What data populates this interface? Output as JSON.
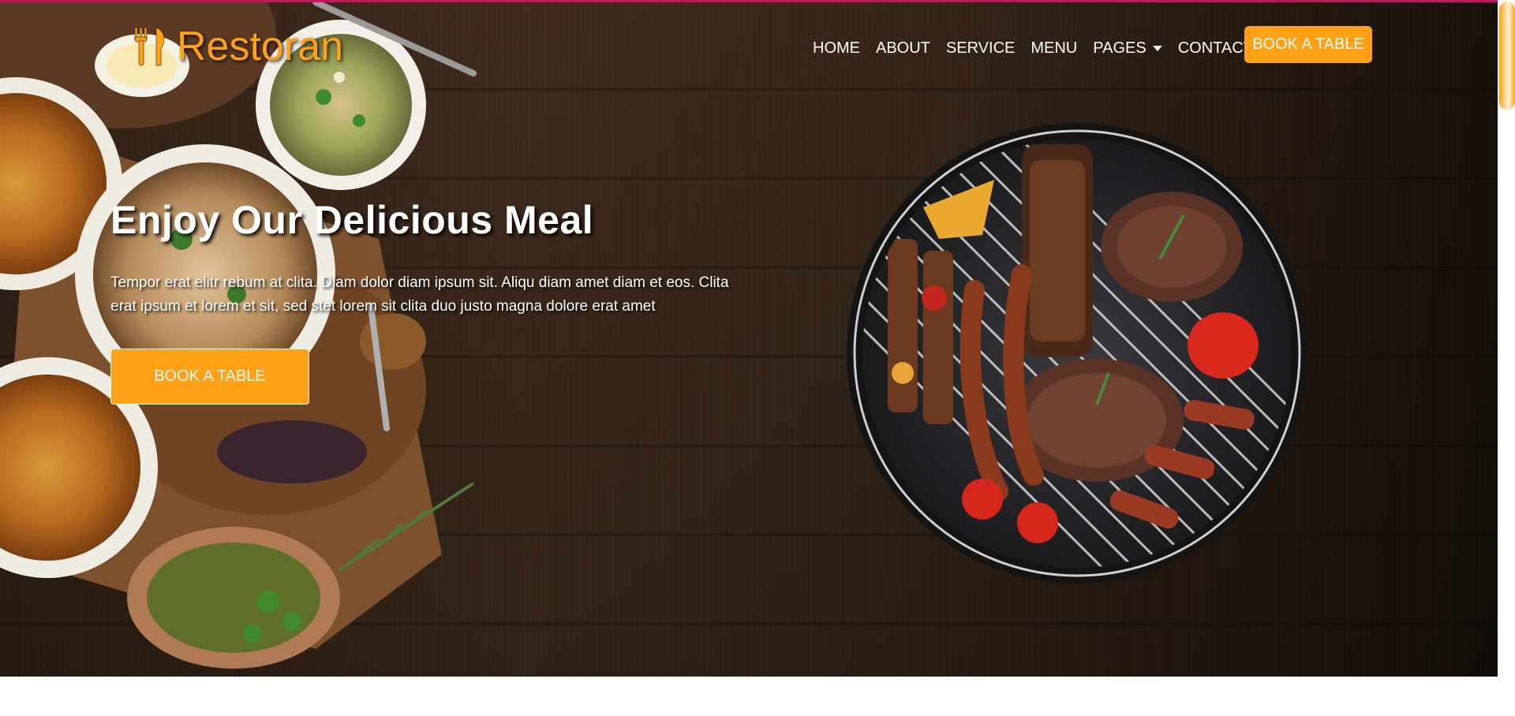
{
  "brand": {
    "name": "Restoran",
    "icon": "utensils-icon",
    "color": "#FEA116"
  },
  "nav": {
    "items": [
      {
        "label": "HOME"
      },
      {
        "label": "ABOUT"
      },
      {
        "label": "SERVICE"
      },
      {
        "label": "MENU"
      },
      {
        "label": "PAGES",
        "dropdown": true
      },
      {
        "label": "CONTACT"
      }
    ],
    "cta_label": "BOOK A TABLE"
  },
  "hero": {
    "title": "Enjoy Our Delicious Meal",
    "text": "Tempor erat elitr rebum at clita. Diam dolor diam ipsum sit. Aliqu diam amet diam et eos. Clita erat ipsum et lorem et sit, sed stet lorem sit clita duo justo magna dolore erat amet",
    "button_label": "BOOK A TABLE"
  },
  "colors": {
    "accent": "#FEA116",
    "top_line": "#c2185b",
    "background": "#3b2719"
  }
}
